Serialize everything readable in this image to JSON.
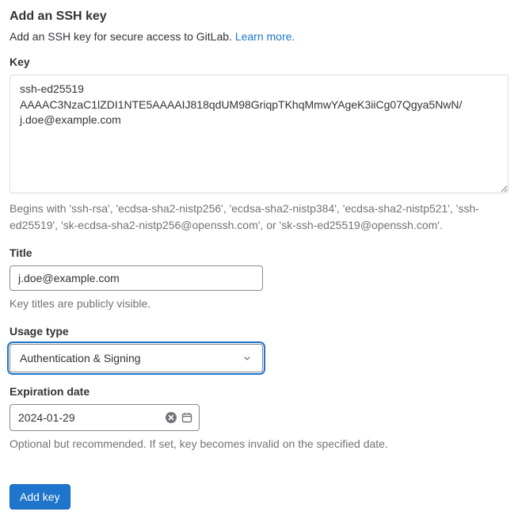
{
  "header": {
    "title": "Add an SSH key",
    "intro_prefix": "Add an SSH key for secure access to GitLab. ",
    "learn_more": "Learn more."
  },
  "key_field": {
    "label": "Key",
    "value": "ssh-ed25519 AAAAC3NzaC1lZDI1NTE5AAAAIJ818qdUM98GriqpTKhqMmwYAgeK3iiCg07Qgya5NwN/ j.doe@example.com",
    "help": "Begins with 'ssh-rsa', 'ecdsa-sha2-nistp256', 'ecdsa-sha2-nistp384', 'ecdsa-sha2-nistp521', 'ssh-ed25519', 'sk-ecdsa-sha2-nistp256@openssh.com', or 'sk-ssh-ed25519@openssh.com'."
  },
  "title_field": {
    "label": "Title",
    "value": "j.doe@example.com",
    "help": "Key titles are publicly visible."
  },
  "usage_field": {
    "label": "Usage type",
    "value": "Authentication & Signing"
  },
  "expiration_field": {
    "label": "Expiration date",
    "value": "2024-01-29",
    "help": "Optional but recommended. If set, key becomes invalid on the specified date."
  },
  "buttons": {
    "add_key": "Add key"
  }
}
